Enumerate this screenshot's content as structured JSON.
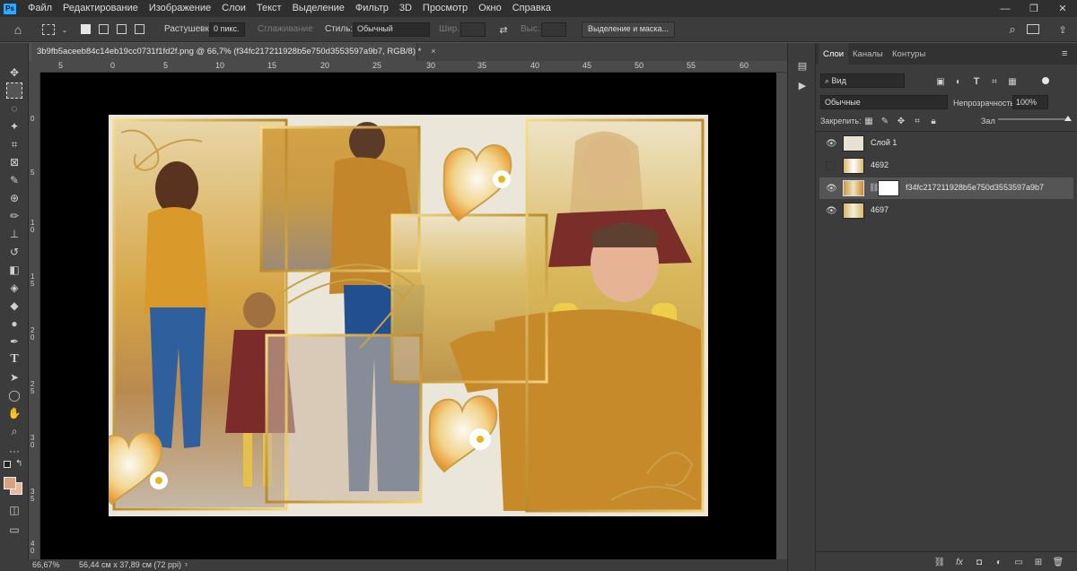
{
  "menubar": {
    "app_icon": "Ps",
    "items": [
      "Файл",
      "Редактирование",
      "Изображение",
      "Слои",
      "Текст",
      "Выделение",
      "Фильтр",
      "3D",
      "Просмотр",
      "Окно",
      "Справка"
    ]
  },
  "options": {
    "feather_label": "Растушевка:",
    "feather_value": "0 пикс.",
    "antialias_label": "Сглаживание",
    "style_label": "Стиль:",
    "style_value": "Обычный",
    "width_label": "Шир.:",
    "height_label": "Выс.:",
    "select_mask_button": "Выделение и маска..."
  },
  "document": {
    "tab_title": "3b9fb5aceeb84c14eb19cc0731f1fd2f.png @ 66,7% (f34fc217211928b5e750d3553597a9b7, RGB/8) *",
    "tab_close": "×"
  },
  "ruler": {
    "top_ticks": [
      "5",
      "0",
      "5",
      "10",
      "15",
      "20",
      "25",
      "30",
      "35",
      "40",
      "45",
      "50",
      "55",
      "60"
    ],
    "left_ticks": [
      "0",
      "5",
      "1\n0",
      "1\n5",
      "2\n0",
      "2\n5",
      "3\n0",
      "3\n5",
      "4\n0"
    ]
  },
  "status": {
    "zoom": "66,67%",
    "dimensions": "56,44 см x 37,89 см (72 ppi)",
    "arrow": "›"
  },
  "layers_panel": {
    "tabs": [
      "Слои",
      "Каналы",
      "Контуры"
    ],
    "filter_value": "Вид",
    "blend_mode": "Обычные",
    "opacity_label": "Непрозрачность:",
    "opacity_value": "100%",
    "lock_label": "Закрепить:",
    "fill_label": "Зал",
    "layers": [
      {
        "name": "Слой 1",
        "visible": true,
        "selected": false
      },
      {
        "name": "4692",
        "visible": false,
        "selected": false
      },
      {
        "name": "f34fc217211928b5e750d3553597a9b7",
        "visible": true,
        "selected": true,
        "has_mask": true
      },
      {
        "name": "4697",
        "visible": true,
        "selected": false
      }
    ]
  },
  "colors": {
    "foreground": "#d9a27c",
    "background": "#e8b89a",
    "accent": "#31a8ff"
  }
}
